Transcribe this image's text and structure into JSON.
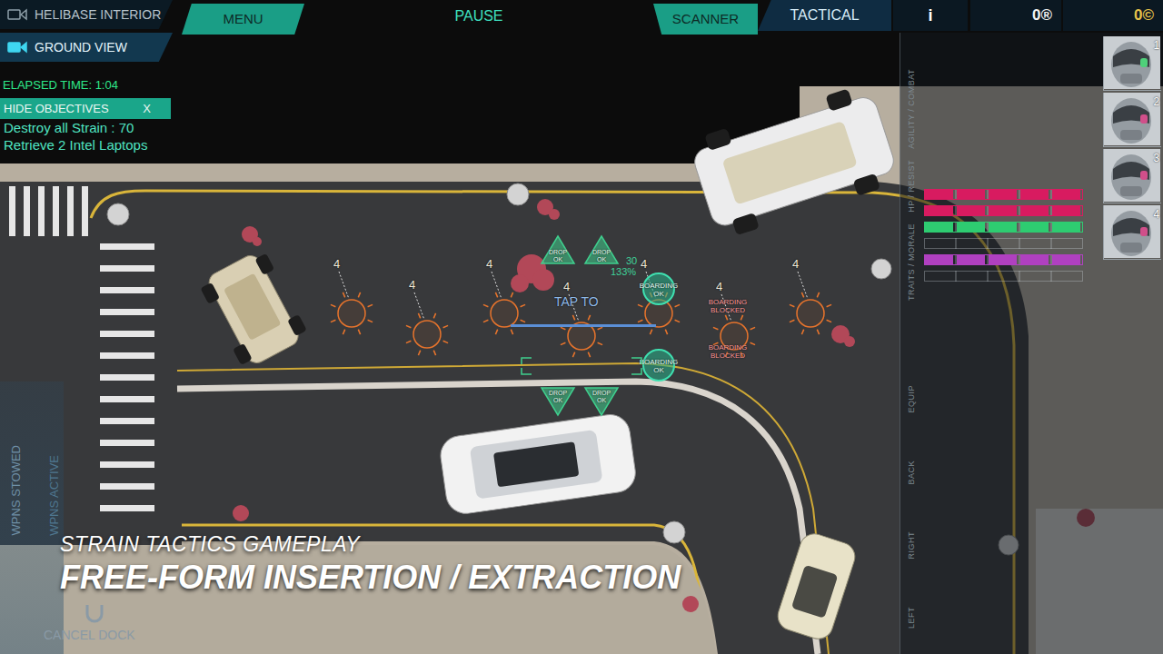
{
  "camera_views": [
    {
      "label": "HELIBASE INTERIOR",
      "selected": false
    },
    {
      "label": "GROUND VIEW",
      "selected": true
    }
  ],
  "top_bar": {
    "menu": "MENU",
    "pause": "PAUSE",
    "scanner": "SCANNER",
    "tactical": "TACTICAL",
    "info": "i",
    "currencies": [
      "0®",
      "0©"
    ]
  },
  "objectives_panel": {
    "elapsed": "ELAPSED TIME: 1:04",
    "toggle": "HIDE OBJECTIVES",
    "close": "X",
    "items": [
      "Destroy all Strain : 70",
      "Retrieve 2 Intel Laptops"
    ]
  },
  "map": {
    "targets": [
      {
        "label": "4"
      },
      {
        "label": "4"
      },
      {
        "label": "4"
      },
      {
        "label": "4"
      },
      {
        "label": "4"
      },
      {
        "label": "4"
      },
      {
        "label": "4"
      }
    ],
    "drop_zones": [
      {
        "label": "DROP OK"
      },
      {
        "label": "DROP OK"
      },
      {
        "label": "DROP OK"
      },
      {
        "label": "DROP OK"
      }
    ],
    "boarding_points": [
      {
        "label": "BOARDING OK",
        "kind": "ok"
      },
      {
        "label": "BOARDING BLOCKED",
        "kind": "blocked"
      },
      {
        "label": "BOARDING BLOCKED",
        "kind": "blocked"
      },
      {
        "label": "BOARDING OK",
        "kind": "ok"
      }
    ],
    "cursor": {
      "label": "TAP TO",
      "count": "30",
      "percent": "133%"
    }
  },
  "side_tabs": [
    "AGILITY / COMBAT",
    "HP / RESIST",
    "TRAITS / MORALE",
    "EQUIP",
    "BACK",
    "RIGHT",
    "LEFT"
  ],
  "stat_bars": [
    {
      "color": "#d81b60",
      "level": 1
    },
    {
      "color": "#d81b60",
      "level": 1
    },
    {
      "color": "#2ecc71",
      "level": 1
    },
    {
      "color": "#2ecc71",
      "level": 0
    },
    {
      "color": "#b040c0",
      "level": 1
    },
    {
      "color": "#b040c0",
      "level": 0
    }
  ],
  "squad": [
    {
      "number": "1",
      "color": "#4fd07a"
    },
    {
      "number": "2",
      "color": "#d04f8a"
    },
    {
      "number": "3",
      "color": "#d04f8a"
    },
    {
      "number": "4",
      "color": "#d04f8a"
    }
  ],
  "weapons": {
    "stowed": "WPNS STOWED",
    "active": "WPNS ACTIVE",
    "cancel": "CANCEL DOCK"
  },
  "caption": {
    "kicker": "STRAIN TACTICS GAMEPLAY",
    "title": "FREE-FORM INSERTION / EXTRACTION"
  }
}
